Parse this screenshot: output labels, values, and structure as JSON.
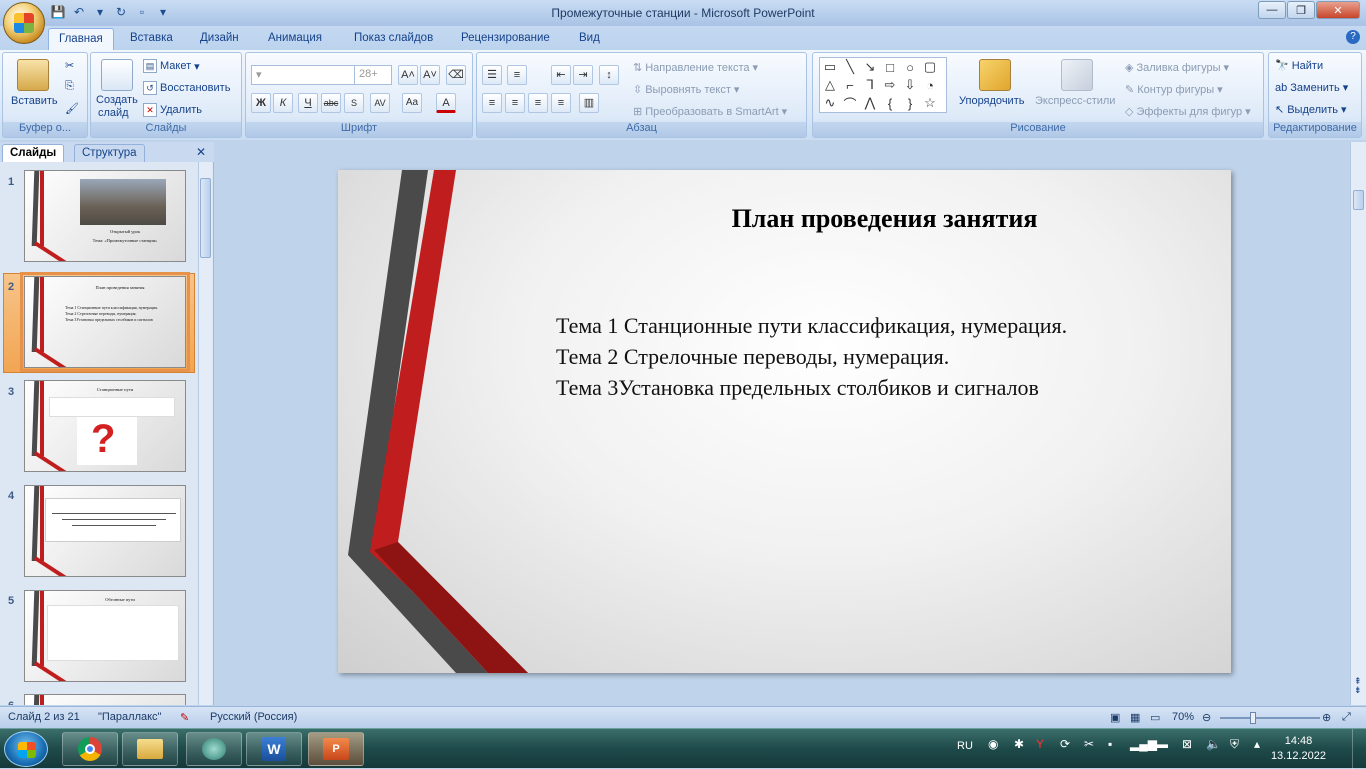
{
  "window": {
    "title": "Промежуточные станции - Microsoft PowerPoint"
  },
  "tabs": [
    "Главная",
    "Вставка",
    "Дизайн",
    "Анимация",
    "Показ слайдов",
    "Рецензирование",
    "Вид"
  ],
  "ribbon": {
    "clipboard": {
      "paste": "Вставить",
      "label": "Буфер о..."
    },
    "slides": {
      "create": "Создать",
      "create2": "слайд",
      "layout": "Макет",
      "reset": "Восстановить",
      "delete": "Удалить",
      "label": "Слайды"
    },
    "font": {
      "size": "28+",
      "label": "Шрифт",
      "bold": "Ж",
      "italic": "К",
      "underline": "Ч",
      "strike": "abc",
      "spacing": "AV",
      "case": "Aa",
      "color": "A"
    },
    "paragraph": {
      "text_direction": "Направление текста",
      "align_text": "Выровнять текст",
      "smartart": "Преобразовать в SmartArt",
      "label": "Абзац"
    },
    "drawing": {
      "arrange": "Упорядочить",
      "quick_styles": "Экспресс-стили",
      "fill": "Заливка фигуры",
      "outline": "Контур фигуры",
      "effects": "Эффекты для фигур",
      "label": "Рисование"
    },
    "editing": {
      "find": "Найти",
      "replace": "Заменить",
      "select": "Выделить",
      "label": "Редактирование"
    }
  },
  "panel": {
    "tab_slides": "Слайды",
    "tab_outline": "Структура"
  },
  "thumbnails": [
    {
      "num": "1",
      "title": "Открытый урок",
      "sub": "Тема: «Промежуточные станции»"
    },
    {
      "num": "2",
      "title": "План проведения занятия",
      "lines": [
        "Тема 1 Станционные пути классификация, нумерация.",
        "Тема 2 Стрелочные переводы, нумерация.",
        "Тема 3Установка предельных столбиков и сигналов"
      ]
    },
    {
      "num": "3",
      "title": "Станционные пути"
    },
    {
      "num": "4"
    },
    {
      "num": "5",
      "title": "Обгонные пути"
    },
    {
      "num": "6"
    }
  ],
  "slide": {
    "title": "План проведения занятия",
    "lines": [
      "Тема 1 Станционные пути классификация, нумерация.",
      "Тема 2 Стрелочные переводы, нумерация.",
      "Тема 3Установка предельных столбиков и сигналов"
    ]
  },
  "status": {
    "slide": "Слайд 2 из 21",
    "theme": "\"Параллакс\"",
    "lang": "Русский (Россия)",
    "zoom": "70%"
  },
  "taskbar": {
    "lang": "RU",
    "time": "14:48",
    "date": "13.12.2022"
  },
  "colors": {
    "accent_red": "#c01e1e",
    "stripe_gray": "#4a4a4a",
    "ribbon_blue": "#15428b"
  }
}
